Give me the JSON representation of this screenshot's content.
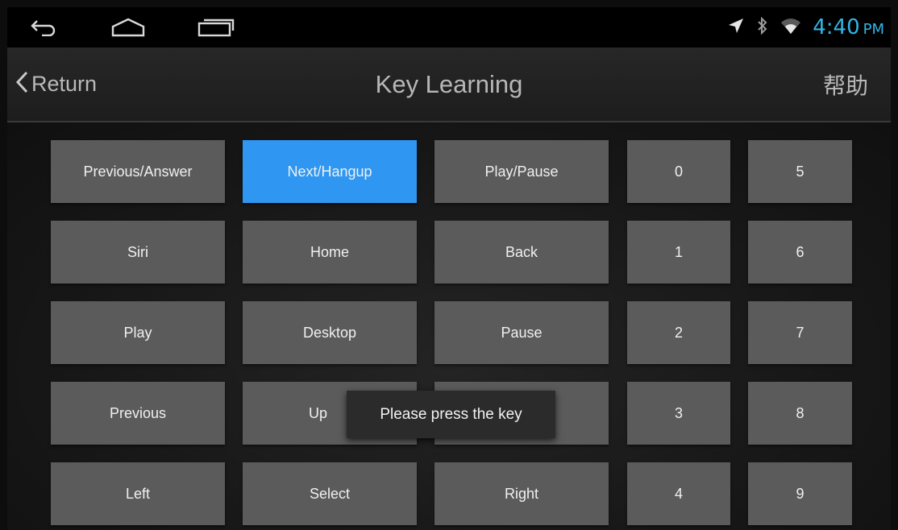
{
  "status_bar": {
    "icons": [
      "back-icon",
      "home-icon",
      "recent-apps-icon",
      "location-icon",
      "bluetooth-icon",
      "wifi-icon"
    ],
    "time": "4:40",
    "ampm": "PM"
  },
  "action_bar": {
    "back_label": "Return",
    "title": "Key Learning",
    "help_label": "帮助"
  },
  "keys": {
    "previous_answer": "Previous/Answer",
    "next_hangup": "Next/Hangup",
    "play_pause": "Play/Pause",
    "num_0": "0",
    "num_5": "5",
    "siri": "Siri",
    "home": "Home",
    "back": "Back",
    "num_1": "1",
    "num_6": "6",
    "play": "Play",
    "desktop": "Desktop",
    "pause": "Pause",
    "num_2": "2",
    "num_7": "7",
    "previous": "Previous",
    "up": "Up",
    "num_3": "3",
    "num_8": "8",
    "left": "Left",
    "select": "Select",
    "right": "Right",
    "num_4": "4",
    "num_9": "9"
  },
  "selected_key": "Next/Hangup",
  "toast": "Please press the key",
  "colors": {
    "accent": "#2f97f1",
    "clock": "#33b5e5",
    "key": "#5b5b5b"
  }
}
